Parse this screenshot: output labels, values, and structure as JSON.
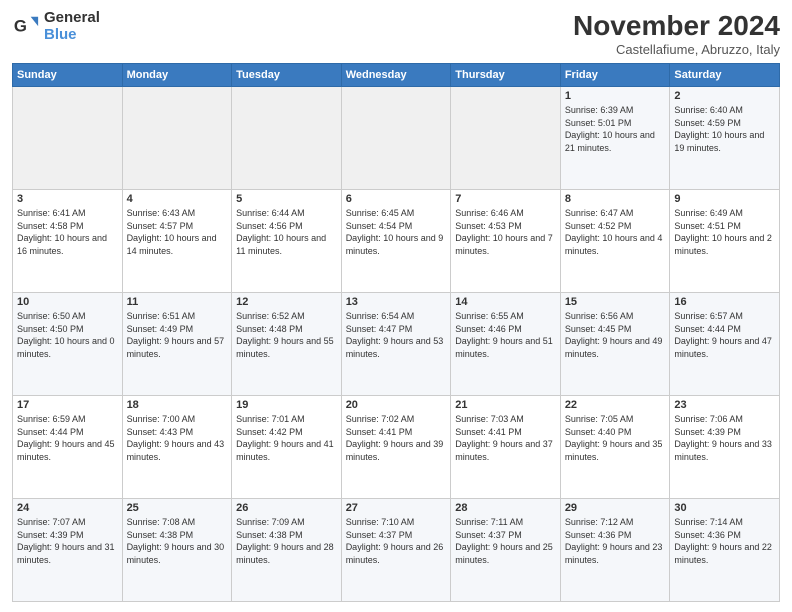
{
  "logo": {
    "general": "General",
    "blue": "Blue"
  },
  "title": "November 2024",
  "location": "Castellafiume, Abruzzo, Italy",
  "headers": [
    "Sunday",
    "Monday",
    "Tuesday",
    "Wednesday",
    "Thursday",
    "Friday",
    "Saturday"
  ],
  "weeks": [
    [
      {
        "day": "",
        "info": ""
      },
      {
        "day": "",
        "info": ""
      },
      {
        "day": "",
        "info": ""
      },
      {
        "day": "",
        "info": ""
      },
      {
        "day": "",
        "info": ""
      },
      {
        "day": "1",
        "info": "Sunrise: 6:39 AM\nSunset: 5:01 PM\nDaylight: 10 hours and 21 minutes."
      },
      {
        "day": "2",
        "info": "Sunrise: 6:40 AM\nSunset: 4:59 PM\nDaylight: 10 hours and 19 minutes."
      }
    ],
    [
      {
        "day": "3",
        "info": "Sunrise: 6:41 AM\nSunset: 4:58 PM\nDaylight: 10 hours and 16 minutes."
      },
      {
        "day": "4",
        "info": "Sunrise: 6:43 AM\nSunset: 4:57 PM\nDaylight: 10 hours and 14 minutes."
      },
      {
        "day": "5",
        "info": "Sunrise: 6:44 AM\nSunset: 4:56 PM\nDaylight: 10 hours and 11 minutes."
      },
      {
        "day": "6",
        "info": "Sunrise: 6:45 AM\nSunset: 4:54 PM\nDaylight: 10 hours and 9 minutes."
      },
      {
        "day": "7",
        "info": "Sunrise: 6:46 AM\nSunset: 4:53 PM\nDaylight: 10 hours and 7 minutes."
      },
      {
        "day": "8",
        "info": "Sunrise: 6:47 AM\nSunset: 4:52 PM\nDaylight: 10 hours and 4 minutes."
      },
      {
        "day": "9",
        "info": "Sunrise: 6:49 AM\nSunset: 4:51 PM\nDaylight: 10 hours and 2 minutes."
      }
    ],
    [
      {
        "day": "10",
        "info": "Sunrise: 6:50 AM\nSunset: 4:50 PM\nDaylight: 10 hours and 0 minutes."
      },
      {
        "day": "11",
        "info": "Sunrise: 6:51 AM\nSunset: 4:49 PM\nDaylight: 9 hours and 57 minutes."
      },
      {
        "day": "12",
        "info": "Sunrise: 6:52 AM\nSunset: 4:48 PM\nDaylight: 9 hours and 55 minutes."
      },
      {
        "day": "13",
        "info": "Sunrise: 6:54 AM\nSunset: 4:47 PM\nDaylight: 9 hours and 53 minutes."
      },
      {
        "day": "14",
        "info": "Sunrise: 6:55 AM\nSunset: 4:46 PM\nDaylight: 9 hours and 51 minutes."
      },
      {
        "day": "15",
        "info": "Sunrise: 6:56 AM\nSunset: 4:45 PM\nDaylight: 9 hours and 49 minutes."
      },
      {
        "day": "16",
        "info": "Sunrise: 6:57 AM\nSunset: 4:44 PM\nDaylight: 9 hours and 47 minutes."
      }
    ],
    [
      {
        "day": "17",
        "info": "Sunrise: 6:59 AM\nSunset: 4:44 PM\nDaylight: 9 hours and 45 minutes."
      },
      {
        "day": "18",
        "info": "Sunrise: 7:00 AM\nSunset: 4:43 PM\nDaylight: 9 hours and 43 minutes."
      },
      {
        "day": "19",
        "info": "Sunrise: 7:01 AM\nSunset: 4:42 PM\nDaylight: 9 hours and 41 minutes."
      },
      {
        "day": "20",
        "info": "Sunrise: 7:02 AM\nSunset: 4:41 PM\nDaylight: 9 hours and 39 minutes."
      },
      {
        "day": "21",
        "info": "Sunrise: 7:03 AM\nSunset: 4:41 PM\nDaylight: 9 hours and 37 minutes."
      },
      {
        "day": "22",
        "info": "Sunrise: 7:05 AM\nSunset: 4:40 PM\nDaylight: 9 hours and 35 minutes."
      },
      {
        "day": "23",
        "info": "Sunrise: 7:06 AM\nSunset: 4:39 PM\nDaylight: 9 hours and 33 minutes."
      }
    ],
    [
      {
        "day": "24",
        "info": "Sunrise: 7:07 AM\nSunset: 4:39 PM\nDaylight: 9 hours and 31 minutes."
      },
      {
        "day": "25",
        "info": "Sunrise: 7:08 AM\nSunset: 4:38 PM\nDaylight: 9 hours and 30 minutes."
      },
      {
        "day": "26",
        "info": "Sunrise: 7:09 AM\nSunset: 4:38 PM\nDaylight: 9 hours and 28 minutes."
      },
      {
        "day": "27",
        "info": "Sunrise: 7:10 AM\nSunset: 4:37 PM\nDaylight: 9 hours and 26 minutes."
      },
      {
        "day": "28",
        "info": "Sunrise: 7:11 AM\nSunset: 4:37 PM\nDaylight: 9 hours and 25 minutes."
      },
      {
        "day": "29",
        "info": "Sunrise: 7:12 AM\nSunset: 4:36 PM\nDaylight: 9 hours and 23 minutes."
      },
      {
        "day": "30",
        "info": "Sunrise: 7:14 AM\nSunset: 4:36 PM\nDaylight: 9 hours and 22 minutes."
      }
    ]
  ]
}
